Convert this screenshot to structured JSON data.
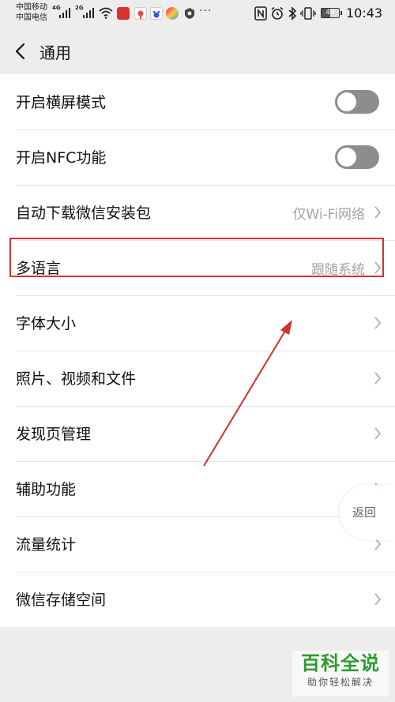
{
  "status_bar": {
    "carrier_1": "中国移动",
    "carrier_2": "中国电信",
    "net_1": "4G",
    "net_2": "2G",
    "battery": "49",
    "time": "10:43",
    "more": "···",
    "icons": [
      "signal-icon",
      "wifi-icon",
      "news-app-icon",
      "map-app-icon",
      "baidu-app-icon",
      "colorful-app-icon",
      "shield-app-icon",
      "nfc-icon",
      "alarm-icon",
      "bluetooth-icon",
      "vibrate-icon",
      "battery-icon"
    ]
  },
  "header": {
    "title": "通用",
    "back_icon": "chevron-left-icon"
  },
  "settings": [
    {
      "label": "开启横屏模式",
      "type": "toggle",
      "on": false
    },
    {
      "label": "开启NFC功能",
      "type": "toggle",
      "on": false
    },
    {
      "label": "自动下载微信安装包",
      "type": "link",
      "value": "仅Wi-Fi网络"
    },
    {
      "label": "多语言",
      "type": "link",
      "value": "跟随系统"
    },
    {
      "label": "字体大小",
      "type": "link"
    },
    {
      "label": "照片、视频和文件",
      "type": "link"
    },
    {
      "label": "发现页管理",
      "type": "link"
    },
    {
      "label": "辅助功能",
      "type": "link"
    },
    {
      "label": "流量统计",
      "type": "link"
    },
    {
      "label": "微信存储空间",
      "type": "link"
    }
  ],
  "float_back": {
    "label": "返回"
  },
  "watermark": {
    "main": "百科全说",
    "sub": "助你轻松解决"
  },
  "colors": {
    "annotation_red": "#d43030",
    "toggle_off": "#8d8d8d",
    "watermark_green": "#2c9c2c"
  }
}
